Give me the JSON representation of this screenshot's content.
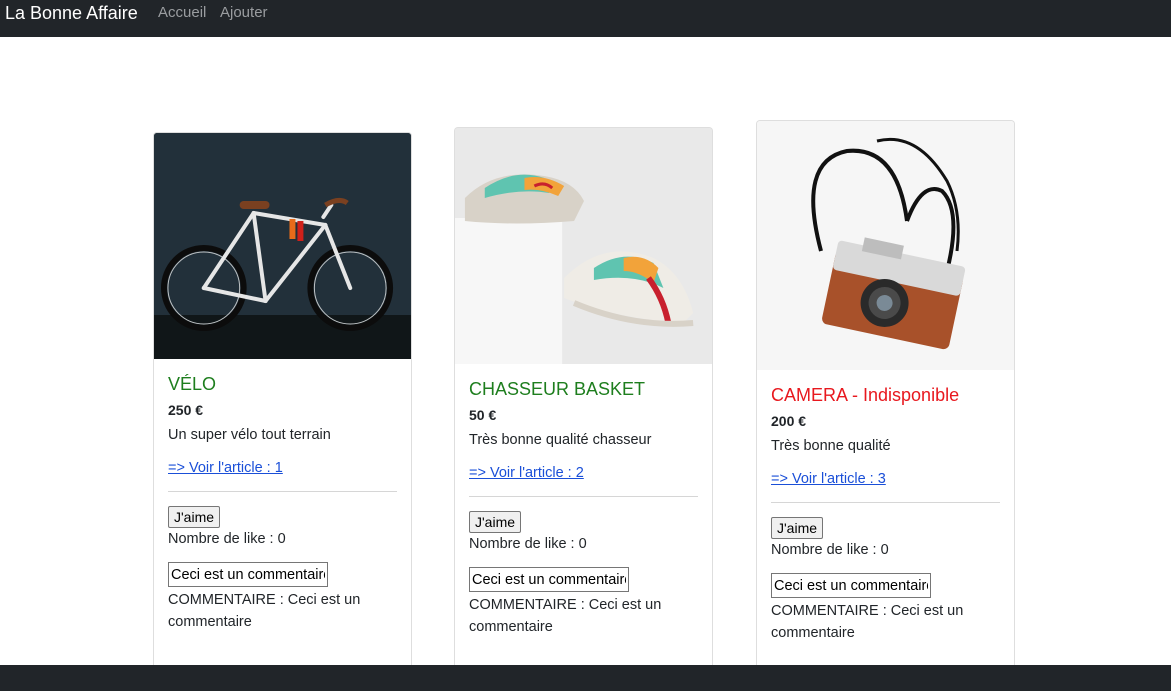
{
  "nav": {
    "brand": "La Bonne Affaire",
    "links": [
      {
        "label": "Accueil"
      },
      {
        "label": "Ajouter"
      }
    ]
  },
  "articles": [
    {
      "title": "VÉLO",
      "title_color": "#1e7e1e",
      "price": "250 €",
      "description": "Un super vélo tout terrain",
      "link": "=> Voir l'article : 1",
      "like_button": "J'aime",
      "likes": "Nombre de like : 0",
      "comment_input": "Ceci est un commentaire",
      "comment": "COMMENTAIRE : Ceci est un commentaire"
    },
    {
      "title": "CHASSEUR BASKET",
      "title_color": "#1e7e1e",
      "price": "50 €",
      "description": "Très bonne qualité chasseur",
      "link": "=> Voir l'article : 2",
      "like_button": "J'aime",
      "likes": "Nombre de like : 0",
      "comment_input": "Ceci est un commentaire",
      "comment": "COMMENTAIRE : Ceci est un commentaire"
    },
    {
      "title": "CAMERA - Indisponible",
      "title_color": "#e8181e",
      "price": "200 €",
      "description": "Très bonne qualité",
      "link": "=> Voir l'article : 3",
      "like_button": "J'aime",
      "likes": "Nombre de like : 0",
      "comment_input": "Ceci est un commentaire",
      "comment": "COMMENTAIRE : Ceci est un commentaire"
    }
  ],
  "colors": {
    "navbar": "#212529",
    "available": "#1e7e1e",
    "unavailable": "#e8181e",
    "link": "#1a4fd8"
  },
  "images": [
    "bicycle-photo",
    "sneakers-photo",
    "camera-photo"
  ]
}
